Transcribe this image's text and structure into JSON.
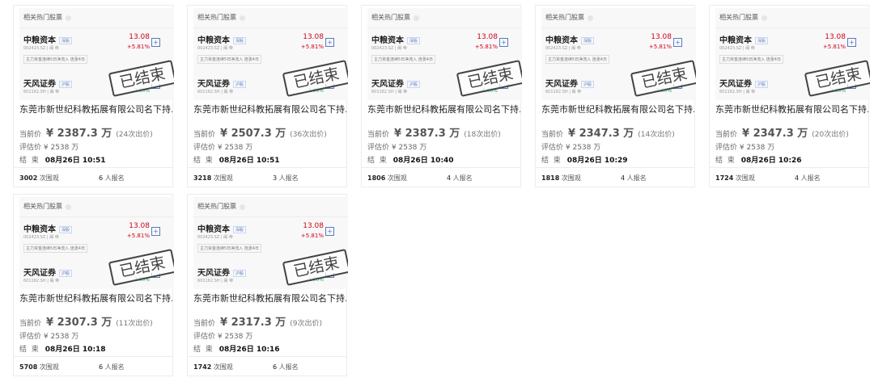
{
  "labels": {
    "current_price": "当前价",
    "valuation": "评估价",
    "end": "结  束",
    "views_suffix": "次围观",
    "signup_suffix": "人报名"
  },
  "thumb": {
    "header": "相关热门股票",
    "stock1_name": "中粮资本",
    "stock1_tag": "深股",
    "stock1_code": "002423.SZ | 闽 帝",
    "stock1_price": "13.08",
    "stock1_change": "+5.81%",
    "chip": "主力资金连续5日净流入  连涨4日",
    "stock2_name": "天风证券",
    "stock2_tag": "沪股",
    "stock2_code": "601162.SH | 闽 帝",
    "stock2_change": "-2.00%",
    "stamp": "已结束",
    "plus": "+"
  },
  "colors": {
    "up": "#d0021b",
    "down": "#1aa37a",
    "tag": "#5a7bc2"
  },
  "cards": [
    {
      "title": "东莞市新世纪科教拓展有限公司名下持...",
      "price": "¥ 2387.3 万",
      "bids": "(24次出价)",
      "valuation": "¥ 2538 万",
      "end": "08月26日 10:51",
      "views": "3002",
      "signups": "6"
    },
    {
      "title": "东莞市新世纪科教拓展有限公司名下持...",
      "price": "¥ 2507.3 万",
      "bids": "(36次出价)",
      "valuation": "¥ 2538 万",
      "end": "08月26日 10:51",
      "views": "3218",
      "signups": "3"
    },
    {
      "title": "东莞市新世纪科教拓展有限公司名下持...",
      "price": "¥ 2387.3 万",
      "bids": "(18次出价)",
      "valuation": "¥ 2538 万",
      "end": "08月26日 10:40",
      "views": "1806",
      "signups": "4"
    },
    {
      "title": "东莞市新世纪科教拓展有限公司名下持...",
      "price": "¥ 2347.3 万",
      "bids": "(14次出价)",
      "valuation": "¥ 2538 万",
      "end": "08月26日 10:29",
      "views": "1818",
      "signups": "4"
    },
    {
      "title": "东莞市新世纪科教拓展有限公司名下持...",
      "price": "¥ 2347.3 万",
      "bids": "(20次出价)",
      "valuation": "¥ 2538 万",
      "end": "08月26日 10:26",
      "views": "1724",
      "signups": "4"
    },
    {
      "title": "东莞市新世纪科教拓展有限公司名下持...",
      "price": "¥ 2307.3 万",
      "bids": "(11次出价)",
      "valuation": "¥ 2538 万",
      "end": "08月26日 10:18",
      "views": "5708",
      "signups": "6"
    },
    {
      "title": "东莞市新世纪科教拓展有限公司名下持...",
      "price": "¥ 2317.3 万",
      "bids": "(9次出价)",
      "valuation": "¥ 2538 万",
      "end": "08月26日 10:16",
      "views": "1742",
      "signups": "6"
    }
  ]
}
